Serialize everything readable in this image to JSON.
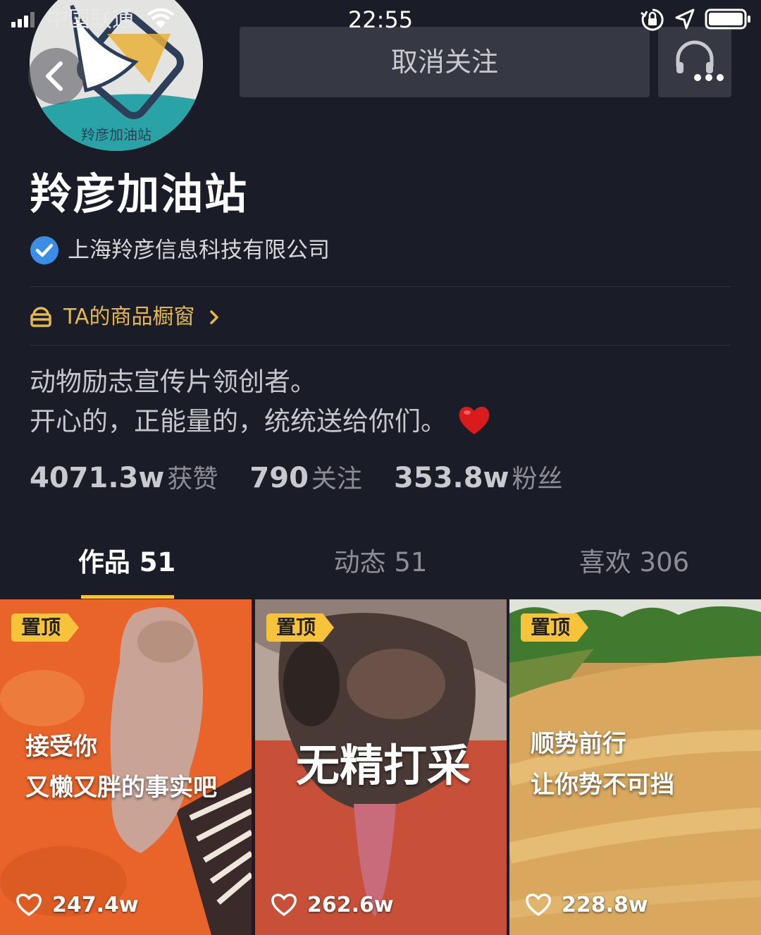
{
  "status_bar": {
    "carrier": "中国联通",
    "time": "22:55"
  },
  "avatar": {
    "label": "羚彦加油站"
  },
  "header": {
    "unfollow_label": "取消关注"
  },
  "profile": {
    "name": "羚彦加油站",
    "company": "上海羚彦信息科技有限公司",
    "shop_label": "TA的商品橱窗",
    "bio_line1": "动物励志宣传片领创者。",
    "bio_line2": "开心的，正能量的，统统送给你们。"
  },
  "stats": [
    {
      "value": "4071.3w",
      "label": "获赞"
    },
    {
      "value": "790",
      "label": "关注"
    },
    {
      "value": "353.8w",
      "label": "粉丝"
    }
  ],
  "tabs": [
    {
      "label": "作品 51",
      "active": true
    },
    {
      "label": "动态 51",
      "active": false
    },
    {
      "label": "喜欢 306",
      "active": false
    }
  ],
  "videos": [
    {
      "pin": "置顶",
      "caption_line1": "接受你",
      "caption_line2": "又懒又胖的事实吧",
      "likes": "247.4w"
    },
    {
      "pin": "置顶",
      "caption_line1": "无精打采",
      "caption_line2": "",
      "likes": "262.6w"
    },
    {
      "pin": "置顶",
      "caption_line1": "顺势前行",
      "caption_line2": "让你势不可挡",
      "likes": "228.8w"
    }
  ],
  "colors": {
    "background": "#1a1c27",
    "accent": "#f7c33b",
    "shop": "#e6b84a",
    "verified": "#3a8ee6"
  }
}
